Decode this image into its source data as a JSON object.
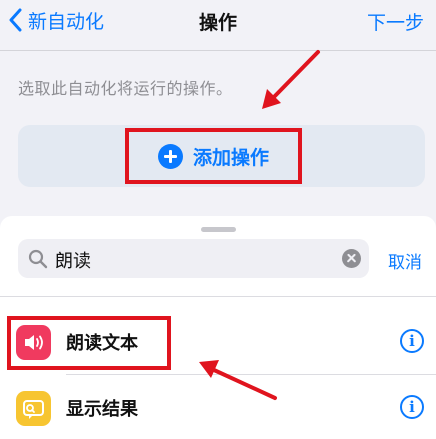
{
  "nav": {
    "back_label": "新自动化",
    "title": "操作",
    "next_label": "下一步"
  },
  "automation": {
    "prompt": "选取此自动化将运行的操作。",
    "add_action_label": "添加操作"
  },
  "search": {
    "value": "朗读",
    "cancel_label": "取消"
  },
  "results": [
    {
      "label": "朗读文本",
      "icon": "speaker-icon",
      "icon_color": "#f03a5f",
      "info": "i"
    },
    {
      "label": "显示结果",
      "icon": "result-bubble-icon",
      "icon_color": "#f7c531",
      "info": "i"
    }
  ],
  "colors": {
    "accent": "#0a7aff",
    "annotation_red": "#e0141e",
    "card_background": "#e3e9f2"
  }
}
